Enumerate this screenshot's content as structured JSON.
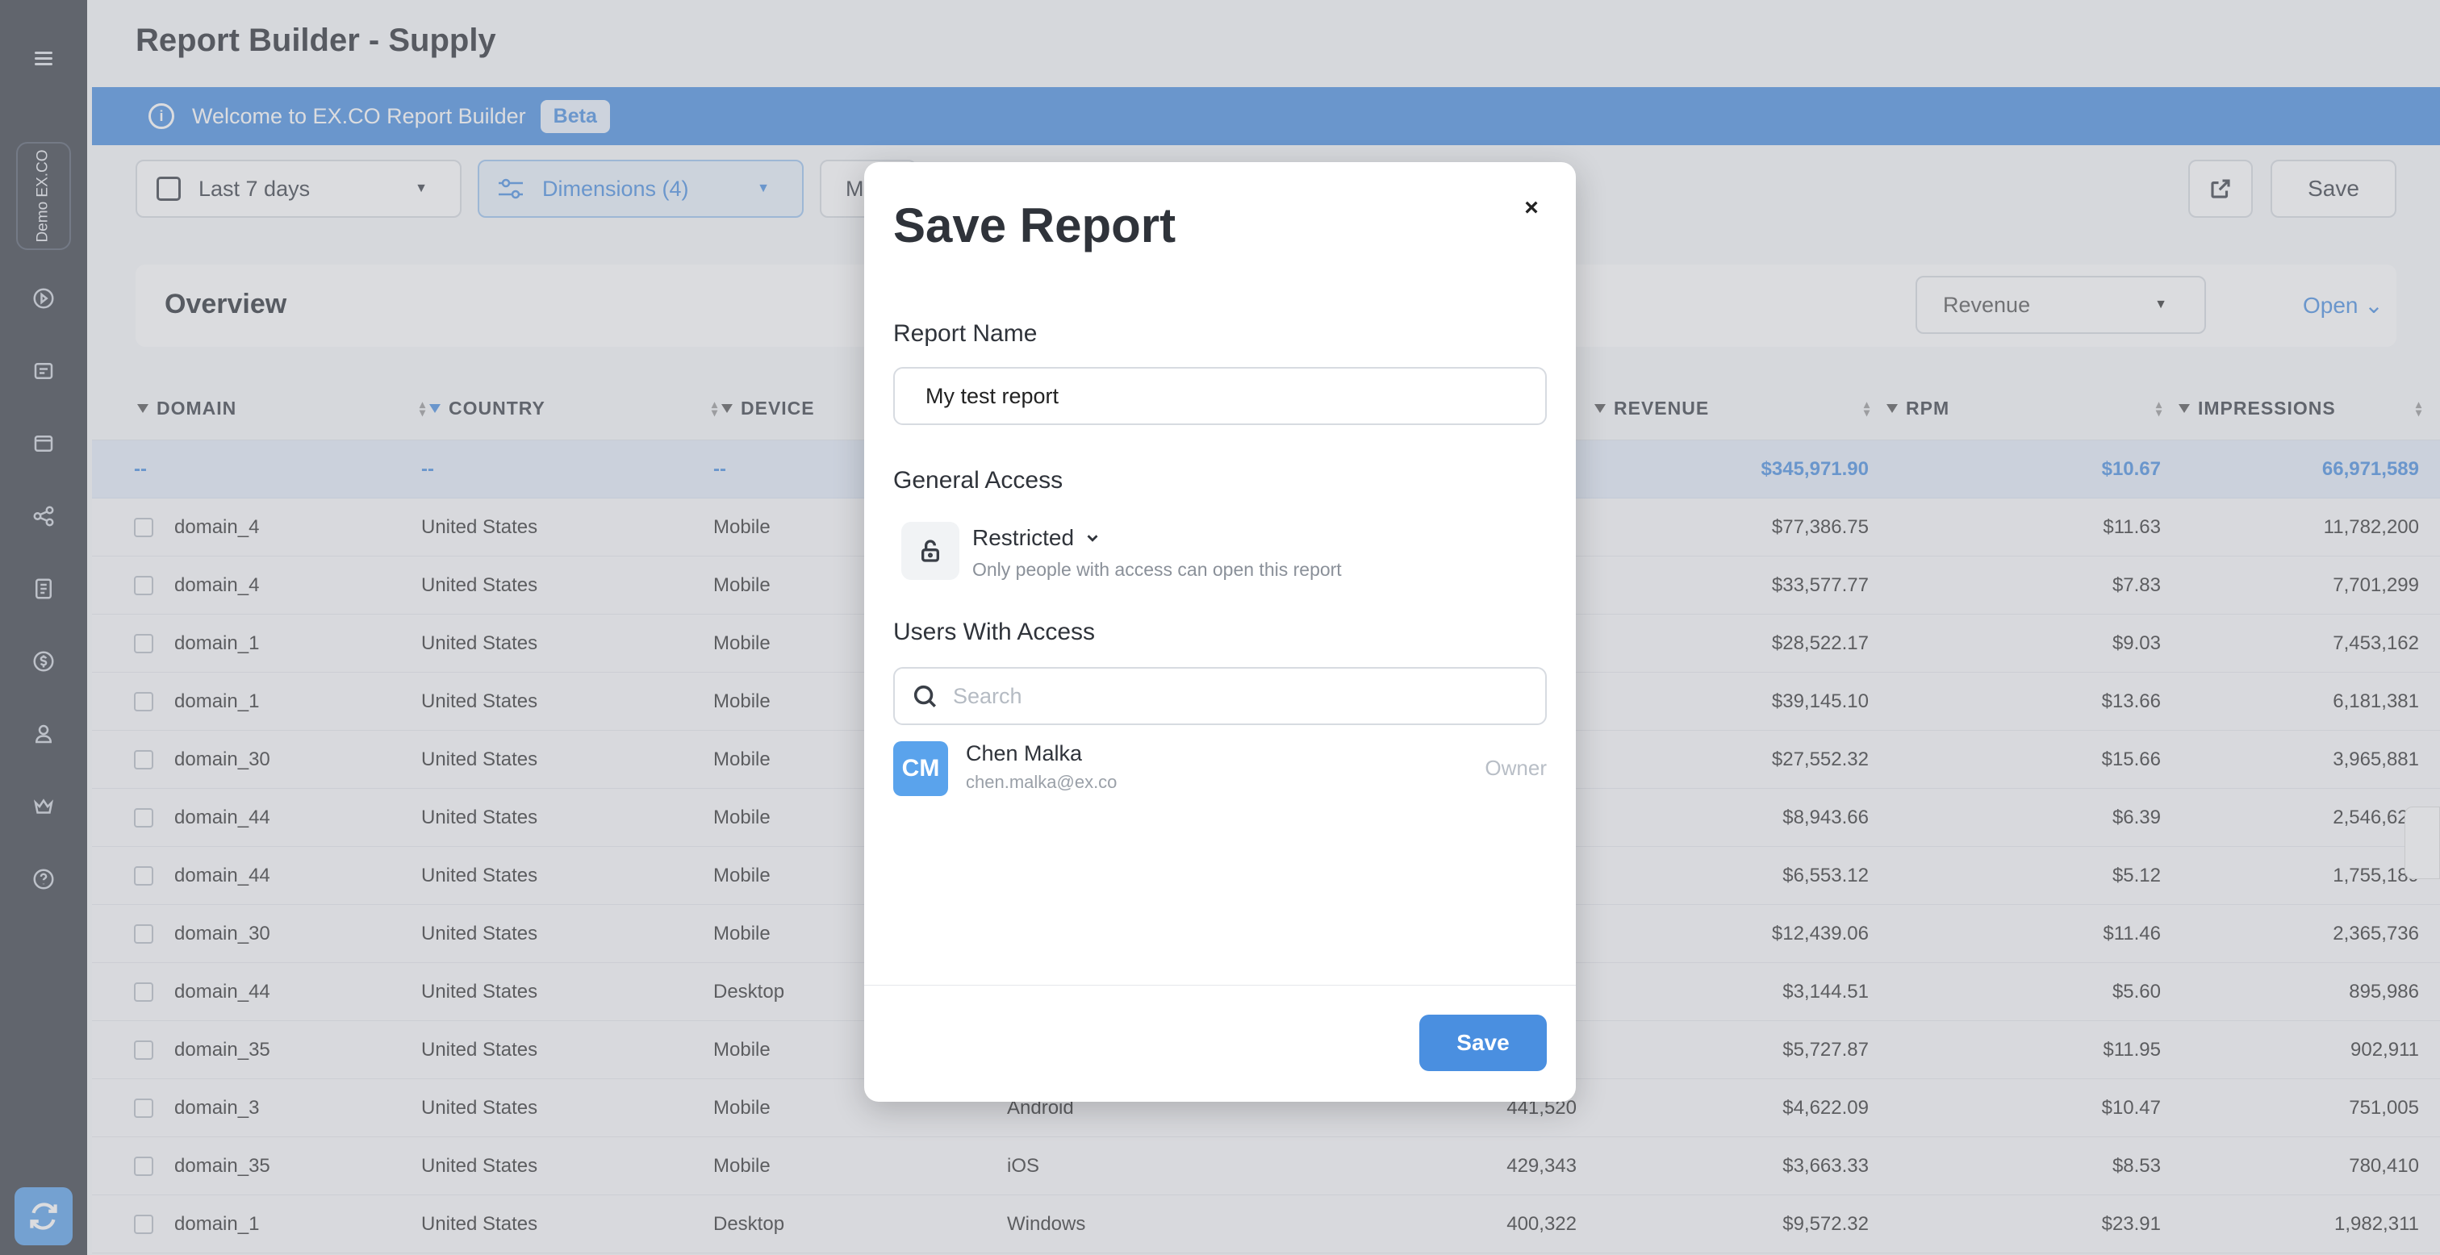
{
  "sidebar": {
    "workspace": "Demo EX.CO",
    "icons": [
      "play-icon",
      "list-icon",
      "media-icon",
      "share-icon",
      "report-icon",
      "dollar-icon",
      "user-icon",
      "crown-icon",
      "help-icon"
    ]
  },
  "header": {
    "title": "Report Builder - Supply"
  },
  "banner": {
    "text": "Welcome to EX.CO Report Builder",
    "badge": "Beta"
  },
  "toolbar": {
    "date_range": "Last 7 days",
    "dimensions": "Dimensions (4)",
    "metrics_partial": "M",
    "save": "Save"
  },
  "overview": {
    "title": "Overview",
    "metric_select": "Revenue",
    "open": "Open"
  },
  "table": {
    "columns": [
      "DOMAIN",
      "COUNTRY",
      "DEVICE",
      "REVENUE",
      "RPM",
      "IMPRESSIONS"
    ],
    "totals": {
      "domain": "--",
      "country": "--",
      "device": "--",
      "revenue": "$345,971.90",
      "rpm": "$10.67",
      "impressions": "66,971,589"
    },
    "rows": [
      {
        "domain": "domain_4",
        "country": "United States",
        "device": "Mobile",
        "os": "",
        "requests": "",
        "revenue": "$77,386.75",
        "rpm": "$11.63",
        "impressions": "11,782,200"
      },
      {
        "domain": "domain_4",
        "country": "United States",
        "device": "Mobile",
        "os": "",
        "requests": "",
        "revenue": "$33,577.77",
        "rpm": "$7.83",
        "impressions": "7,701,299"
      },
      {
        "domain": "domain_1",
        "country": "United States",
        "device": "Mobile",
        "os": "",
        "requests": "",
        "revenue": "$28,522.17",
        "rpm": "$9.03",
        "impressions": "7,453,162"
      },
      {
        "domain": "domain_1",
        "country": "United States",
        "device": "Mobile",
        "os": "",
        "requests": "",
        "revenue": "$39,145.10",
        "rpm": "$13.66",
        "impressions": "6,181,381"
      },
      {
        "domain": "domain_30",
        "country": "United States",
        "device": "Mobile",
        "os": "",
        "requests": "",
        "revenue": "$27,552.32",
        "rpm": "$15.66",
        "impressions": "3,965,881"
      },
      {
        "domain": "domain_44",
        "country": "United States",
        "device": "Mobile",
        "os": "",
        "requests": "",
        "revenue": "$8,943.66",
        "rpm": "$6.39",
        "impressions": "2,546,629"
      },
      {
        "domain": "domain_44",
        "country": "United States",
        "device": "Mobile",
        "os": "",
        "requests": "",
        "revenue": "$6,553.12",
        "rpm": "$5.12",
        "impressions": "1,755,189"
      },
      {
        "domain": "domain_30",
        "country": "United States",
        "device": "Mobile",
        "os": "",
        "requests": "",
        "revenue": "$12,439.06",
        "rpm": "$11.46",
        "impressions": "2,365,736"
      },
      {
        "domain": "domain_44",
        "country": "United States",
        "device": "Desktop",
        "os": "",
        "requests": "",
        "revenue": "$3,144.51",
        "rpm": "$5.60",
        "impressions": "895,986"
      },
      {
        "domain": "domain_35",
        "country": "United States",
        "device": "Mobile",
        "os": "",
        "requests": "",
        "revenue": "$5,727.87",
        "rpm": "$11.95",
        "impressions": "902,911"
      },
      {
        "domain": "domain_3",
        "country": "United States",
        "device": "Mobile",
        "os": "Android",
        "requests": "441,520",
        "revenue": "$4,622.09",
        "rpm": "$10.47",
        "impressions": "751,005"
      },
      {
        "domain": "domain_35",
        "country": "United States",
        "device": "Mobile",
        "os": "iOS",
        "requests": "429,343",
        "revenue": "$3,663.33",
        "rpm": "$8.53",
        "impressions": "780,410"
      },
      {
        "domain": "domain_1",
        "country": "United States",
        "device": "Desktop",
        "os": "Windows",
        "requests": "400,322",
        "revenue": "$9,572.32",
        "rpm": "$23.91",
        "impressions": "1,982,311"
      }
    ]
  },
  "modal": {
    "title": "Save Report",
    "close": "×",
    "report_name_label": "Report Name",
    "report_name_value": "My test report",
    "general_access_label": "General Access",
    "access_mode": "Restricted",
    "access_desc": "Only people with access can open this report",
    "users_label": "Users With Access",
    "search_placeholder": "Search",
    "user": {
      "initials": "CM",
      "name": "Chen Malka",
      "email": "chen.malka@ex.co",
      "role": "Owner"
    },
    "save": "Save"
  },
  "colors": {
    "accent": "#4a8fe0",
    "sidebar": "#3a3f47"
  }
}
